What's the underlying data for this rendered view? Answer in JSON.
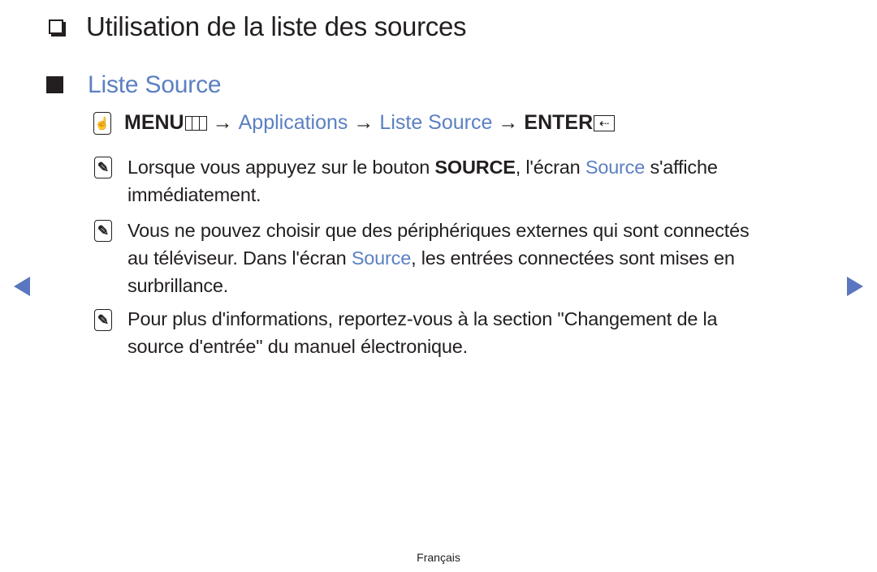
{
  "heading": {
    "icon": "hollow-square-bullet",
    "title": "Utilisation de la liste des sources"
  },
  "subheading": {
    "icon": "filled-square-bullet",
    "title": "Liste Source"
  },
  "menu_path": {
    "icon": "remote-hand-icon",
    "menu_label": "MENU",
    "menu_icon": "menu-grid-icon",
    "arrow": "→",
    "step1": "Applications",
    "step2": "Liste Source",
    "enter_label": "ENTER",
    "enter_icon": "enter-return-icon"
  },
  "notes": [
    {
      "icon": "note-icon",
      "pre": "Lorsque vous appuyez sur le bouton ",
      "bold": "SOURCE",
      "mid": ", l'écran ",
      "link": "Source",
      "post": " s'affiche",
      "line2": "immédiatement."
    },
    {
      "icon": "note-icon",
      "line1": "Vous ne pouvez choisir que des périphériques externes qui sont connectés",
      "line2_pre": "au téléviseur. Dans l'écran ",
      "line2_link": "Source",
      "line2_post": ", les entrées connectées sont mises en",
      "line3": "surbrillance."
    },
    {
      "icon": "note-icon",
      "line1": "Pour plus d'informations, reportez-vous à la section \"Changement de la",
      "line2": "source d'entrée\" du manuel électronique."
    }
  ],
  "navigation": {
    "prev_icon": "left-triangle-icon",
    "next_icon": "right-triangle-icon"
  },
  "footer": {
    "language": "Français"
  },
  "colors": {
    "accent": "#5b80c2",
    "text": "#231f20",
    "nav_arrow": "#5b76c0"
  }
}
